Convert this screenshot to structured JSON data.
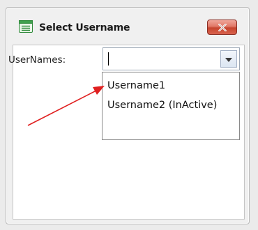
{
  "dialog": {
    "title": "Select Username",
    "icon": "form-icon",
    "close_icon": "close-icon"
  },
  "form": {
    "usernames_label": "UserNames:",
    "combo_value": ""
  },
  "dropdown": {
    "options": [
      {
        "label": "Username1"
      },
      {
        "label": "Username2 (InActive)"
      }
    ]
  },
  "colors": {
    "close_button": "#d8624d",
    "annotation_arrow": "#e02020",
    "window_background": "#f0f0f0"
  }
}
